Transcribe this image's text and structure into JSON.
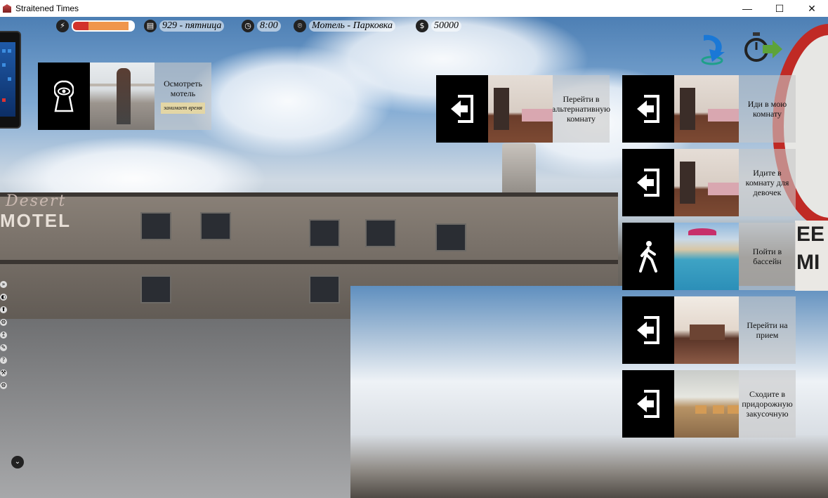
{
  "window": {
    "title": "Straitened Times",
    "minimize": "—",
    "maximize": "☐",
    "close": "✕"
  },
  "hud": {
    "energy": {
      "icon": "lightning-icon",
      "level": 0.92,
      "critical": 0.26
    },
    "day": {
      "icon": "calendar-icon",
      "text": "929 - пятница"
    },
    "time": {
      "icon": "clock-icon",
      "text": "8:00"
    },
    "location": {
      "icon": "map-pin-icon",
      "text": "Мотель - Парковка"
    },
    "money": {
      "icon": "dollar-icon",
      "text": "50000"
    }
  },
  "top_right": {
    "travel": "map-arrow-icon",
    "wait": "stopwatch-forward-icon"
  },
  "scene": {
    "sign_script": "Desert",
    "sign_word": "MOTEL",
    "roadside_sign": "EE MI"
  },
  "left_actions": [
    {
      "icon": "keyhole-eye-icon",
      "label": "Осмотреть мотель",
      "sub": "занимает время"
    }
  ],
  "actions": [
    {
      "icon": "door-enter-icon",
      "label": "Перейти в альтернативную комнату",
      "image": "room"
    },
    {
      "icon": "door-enter-icon",
      "label": "Иди в мою комнату",
      "image": "room"
    },
    {
      "icon": "door-enter-icon",
      "label": "Идите в комнату для девочек",
      "image": "room"
    },
    {
      "icon": "walk-icon",
      "label": "Пойти в бассейн",
      "image": "pool"
    },
    {
      "icon": "door-enter-icon",
      "label": "Перейти на прием",
      "image": "lobby"
    },
    {
      "icon": "door-enter-icon",
      "label": "Сходите в придорожную закусочную",
      "image": "diner"
    }
  ],
  "side_tools": [
    "»",
    "◐",
    "⬆",
    "⚙",
    "↥",
    "✎",
    "?",
    "⚒",
    "⚙"
  ],
  "down_button": "⌄"
}
